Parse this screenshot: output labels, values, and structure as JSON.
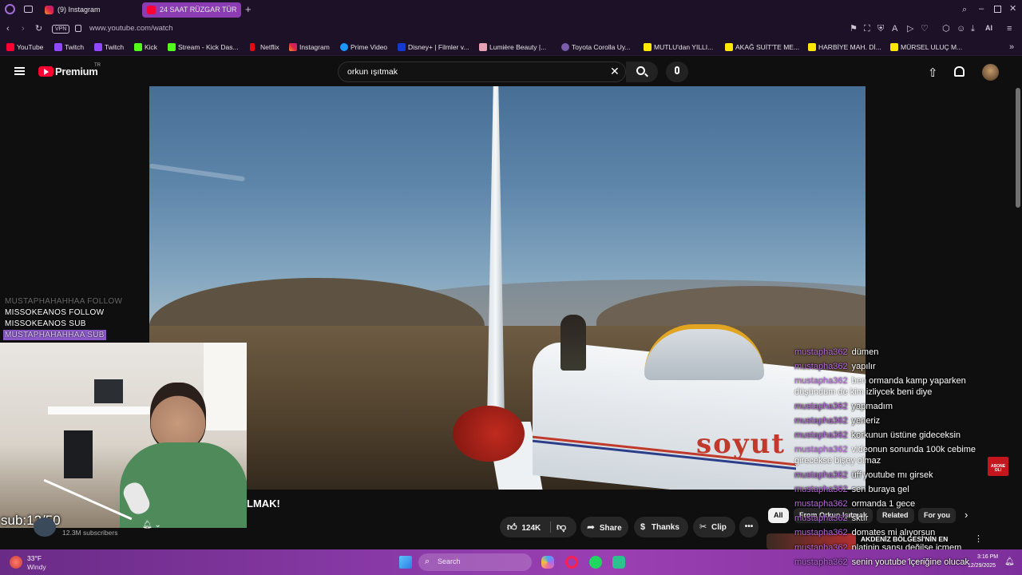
{
  "browser": {
    "tabs": [
      {
        "label": "(9) Instagram"
      },
      {
        "label": "24 SAAT RÜZGAR TÜR"
      }
    ],
    "url": "www.youtube.com/watch",
    "vpn_label": "VPN",
    "ai_label": "AI",
    "bookmarks": [
      {
        "label": "YouTube"
      },
      {
        "label": "Twitch"
      },
      {
        "label": "Twitch"
      },
      {
        "label": "Kick"
      },
      {
        "label": "Stream - Kick Das..."
      },
      {
        "label": "Netflix"
      },
      {
        "label": "Instagram"
      },
      {
        "label": "Prime Video"
      },
      {
        "label": "Disney+ | Filmler v..."
      },
      {
        "label": "Lumière Beauty |..."
      },
      {
        "label": "Toyota Corolla Uy..."
      },
      {
        "label": "MUTLU'dan YILLI..."
      },
      {
        "label": "AKAĞ SUİT'TE ME..."
      },
      {
        "label": "HARBİYE MAH. Dİ..."
      },
      {
        "label": "MÜRSEL ULUÇ M..."
      }
    ]
  },
  "youtube": {
    "logo_text": "Premium",
    "logo_badge": "TR",
    "search_value": "orkun ışıtmak",
    "video_title_fragment": "LMAK!",
    "subscribers": "12.3M subscribers",
    "actions": {
      "likes": "124K",
      "share": "Share",
      "thanks": "Thanks",
      "clip": "Clip"
    },
    "chips": [
      "All",
      "From Orkun Işıtmak",
      "Related",
      "For you"
    ],
    "suggested_snippet": "AKDENİZ BÖLGESİ'NİN EN"
  },
  "video": {
    "plane_text": "soyut"
  },
  "stream_overlay": {
    "alerts": [
      {
        "text": "MUSTAPHAHAHHAA FOLLOW"
      },
      {
        "text": "MISSOKEANOS FOLLOW"
      },
      {
        "text": "MISSOKEANOS SUB"
      },
      {
        "text": "MUSTAPHAHAHHAA SUB"
      }
    ],
    "sub_goal": "sub:12/50",
    "abone_badge": "ABONE OL!"
  },
  "chat": [
    {
      "user": "mustapha362",
      "message": "dümen"
    },
    {
      "user": "mustapha362",
      "message": "yapılır"
    },
    {
      "user": "mustapha362",
      "message": "ben ormanda kamp yaparken düşündüm de kim izliycek beni diye"
    },
    {
      "user": "mustapha362",
      "message": "yapmadım"
    },
    {
      "user": "mustapha362",
      "message": "yeneriz"
    },
    {
      "user": "mustapha362",
      "message": "korkunun üstüne gideceksin"
    },
    {
      "user": "mustapha362",
      "message": "videonun sonunda 100k cebime girecekse bişey olmaz"
    },
    {
      "user": "mustapha362",
      "message": "üff youtube mı girsek"
    },
    {
      "user": "mustapha362",
      "message": "sen buraya gel"
    },
    {
      "user": "mustapha362",
      "message": "ormanda 1 gece"
    },
    {
      "user": "mustapha362",
      "message": "sktır"
    },
    {
      "user": "mustapha362",
      "message": "domates mi alıyorsun"
    },
    {
      "user": "mustapha362",
      "message": "platinin sansı değilse içmem"
    },
    {
      "user": "mustapha362",
      "message": "senin youtube içeriğine olucak"
    }
  ],
  "taskbar": {
    "weather_temp": "33°F",
    "weather_desc": "Windy",
    "search_label": "Search",
    "time": "3:16 PM",
    "date": "12/29/2025"
  },
  "colors": {
    "chat_user": "#b56ad6",
    "taskbar": "#8a3aa8",
    "browser_bg": "#1d1128",
    "yt_red": "#ff0033"
  }
}
